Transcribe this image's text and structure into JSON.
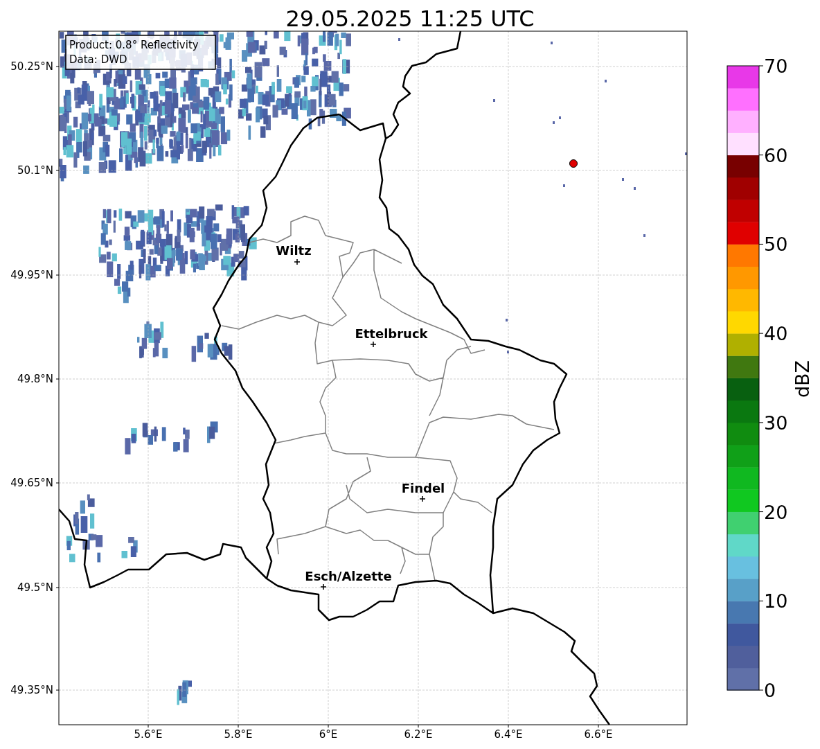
{
  "title": "29.05.2025 11:25 UTC",
  "map": {
    "legend": [
      "Product: 0.8° Reflectivity",
      "Data: DWD"
    ],
    "y_ticks": [
      "50.25°N",
      "50.1°N",
      "49.95°N",
      "49.8°N",
      "49.65°N",
      "49.5°N",
      "49.35°N"
    ],
    "x_ticks": [
      "5.6°E",
      "5.8°E",
      "6°E",
      "6.2°E",
      "6.4°E",
      "6.6°E"
    ],
    "cities": [
      {
        "name": "Wiltz"
      },
      {
        "name": "Ettelbruck"
      },
      {
        "name": "Findel"
      },
      {
        "name": "Esch/Alzette"
      }
    ]
  },
  "colorbar": {
    "label": "dBZ",
    "ticks": [
      "70",
      "60",
      "50",
      "40",
      "30",
      "20",
      "10",
      "0"
    ],
    "bins": [
      {
        "color": "#6070a8"
      },
      {
        "color": "#505f9c"
      },
      {
        "color": "#40589e"
      },
      {
        "color": "#4878b0"
      },
      {
        "color": "#58a0c8"
      },
      {
        "color": "#68c0e0"
      },
      {
        "color": "#60d8c8"
      },
      {
        "color": "#40d070"
      },
      {
        "color": "#10c820"
      },
      {
        "color": "#10b820"
      },
      {
        "color": "#10a018"
      },
      {
        "color": "#108c10"
      },
      {
        "color": "#0a7810"
      },
      {
        "color": "#086010"
      },
      {
        "color": "#407810"
      },
      {
        "color": "#b0b000"
      },
      {
        "color": "#ffd800"
      },
      {
        "color": "#ffb800"
      },
      {
        "color": "#ff9800"
      },
      {
        "color": "#ff7800"
      },
      {
        "color": "#e00000"
      },
      {
        "color": "#c00000"
      },
      {
        "color": "#a00000"
      },
      {
        "color": "#780000"
      },
      {
        "color": "#ffe0ff"
      },
      {
        "color": "#ffb0ff"
      },
      {
        "color": "#ff70ff"
      },
      {
        "color": "#e838e8"
      }
    ]
  }
}
